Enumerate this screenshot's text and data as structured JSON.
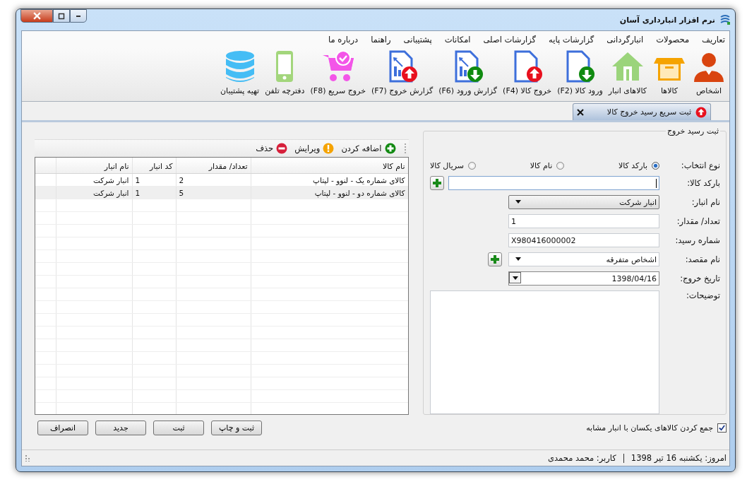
{
  "window": {
    "title": "نرم افزار انبارداری آسان"
  },
  "menu": [
    {
      "label": "تعاریف"
    },
    {
      "label": "محصولات"
    },
    {
      "label": "انبارگردانی"
    },
    {
      "label": "گزارشات پایه"
    },
    {
      "label": "گزارشات اصلی"
    },
    {
      "label": "امکانات"
    },
    {
      "label": "پشتیبانی"
    },
    {
      "label": "راهنما"
    },
    {
      "label": "درباره ما"
    }
  ],
  "toolbar": [
    {
      "label": "اشخاص",
      "kind": "person"
    },
    {
      "label": "کالاها",
      "kind": "box"
    },
    {
      "label": "کالاهای انبار",
      "kind": "house"
    },
    {
      "label": "ورود کالا (F2)",
      "kind": "doc-in"
    },
    {
      "label": "خروج کالا (F4)",
      "kind": "doc-out"
    },
    {
      "label": "گزارش ورود (F6)",
      "kind": "report-in"
    },
    {
      "label": "گزارش خروج (F7)",
      "kind": "report-out"
    },
    {
      "label": "خروج سریع (F8)",
      "kind": "cart"
    },
    {
      "label": "دفترچه تلفن",
      "kind": "phone"
    },
    {
      "label": "تهیه پشتیبان",
      "kind": "database"
    }
  ],
  "tabs": [
    {
      "label": "ثبت سریع رسید خروج کالا",
      "selected": true
    }
  ],
  "form": {
    "title": "ثبت رسید خروج",
    "fields": [
      {
        "kind": "radio",
        "label": "نوع انتخاب:",
        "options": [
          {
            "label": "بارکد کالا",
            "selected": true
          },
          {
            "label": "نام کالا",
            "selected": false
          },
          {
            "label": "سریال کالا",
            "selected": false
          }
        ]
      },
      {
        "kind": "barcode",
        "label": "بارکد کالا:"
      },
      {
        "kind": "dropdown",
        "label": "نام انبار:",
        "value": "انبار شرکت"
      },
      {
        "kind": "text",
        "label": "تعداد/ مقدار:",
        "value": "1"
      },
      {
        "kind": "text",
        "label": "شماره رسید:",
        "value": "X980416000002"
      },
      {
        "kind": "combo",
        "label": "نام مقصد:",
        "value": "اشخاص متفرقه"
      },
      {
        "kind": "date",
        "label": "تاریخ خروج:",
        "value": "1398/04/16"
      },
      {
        "kind": "textarea",
        "label": "توضیحات:"
      }
    ]
  },
  "grid": {
    "actions": [
      {
        "label": "اضافه کردن",
        "kind": "add"
      },
      {
        "label": "ویرایش",
        "kind": "edit"
      },
      {
        "label": "حذف",
        "kind": "delete"
      }
    ],
    "columns": [
      "نام کالا",
      "تعداد/ مقدار",
      "کد انبار",
      "نام انبار"
    ],
    "rows": [
      {
        "cells": [
          "کالای شماره یک - لنوو - لپتاپ",
          "2",
          "1",
          "انبار شرکت"
        ],
        "selected": false
      },
      {
        "cells": [
          "کالای شماره دو - لنوو - لپتاپ",
          "5",
          "1",
          "انبار شرکت"
        ],
        "selected": true
      }
    ]
  },
  "merge_option": {
    "label": "جمع کردن کالاهای یکسان با انبار مشابه",
    "checked": true
  },
  "buttons": [
    "ثبت و چاپ",
    "ثبت",
    "جدید",
    "انصراف"
  ],
  "status_bar": {
    "date": "امروز: یکشنبه 16 تیر 1398",
    "user": "کاربر: محمد محمدی"
  }
}
